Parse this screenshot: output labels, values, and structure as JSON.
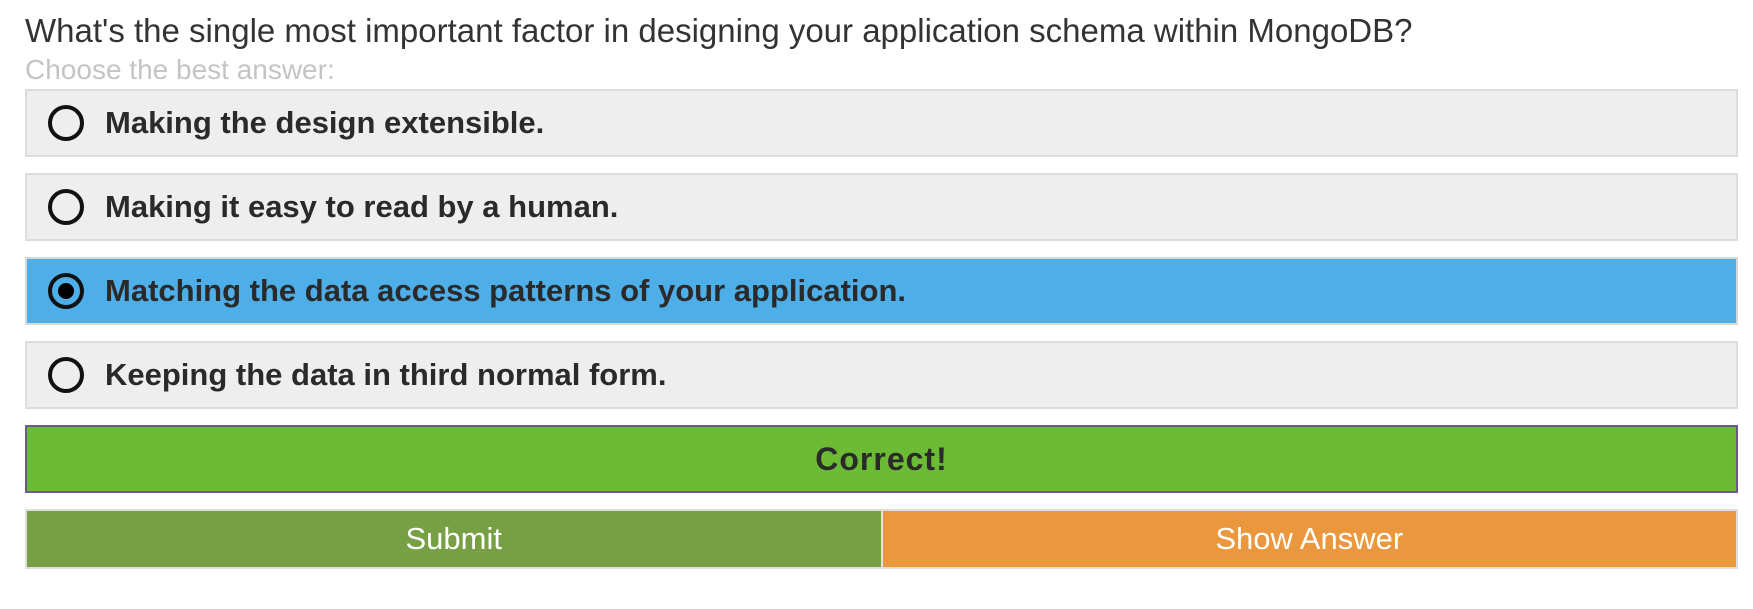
{
  "question": {
    "text": "What's the single most important factor in designing your application schema within MongoDB?",
    "hint": "Choose the best answer:"
  },
  "options": [
    {
      "label": "Making the design extensible.",
      "selected": false
    },
    {
      "label": "Making it easy to read by a human.",
      "selected": false
    },
    {
      "label": "Matching the data access patterns of your application.",
      "selected": true
    },
    {
      "label": "Keeping the data in third normal form.",
      "selected": false
    }
  ],
  "result": {
    "text": "Correct!"
  },
  "actions": {
    "submit_label": "Submit",
    "show_answer_label": "Show Answer"
  },
  "colors": {
    "selected_option": "#4eaee8",
    "option_background": "#eeeeee",
    "correct_banner": "#6cbb35",
    "submit_button": "#77a045",
    "show_answer_button": "#ea973e",
    "hint_text": "#c4c4c4"
  }
}
